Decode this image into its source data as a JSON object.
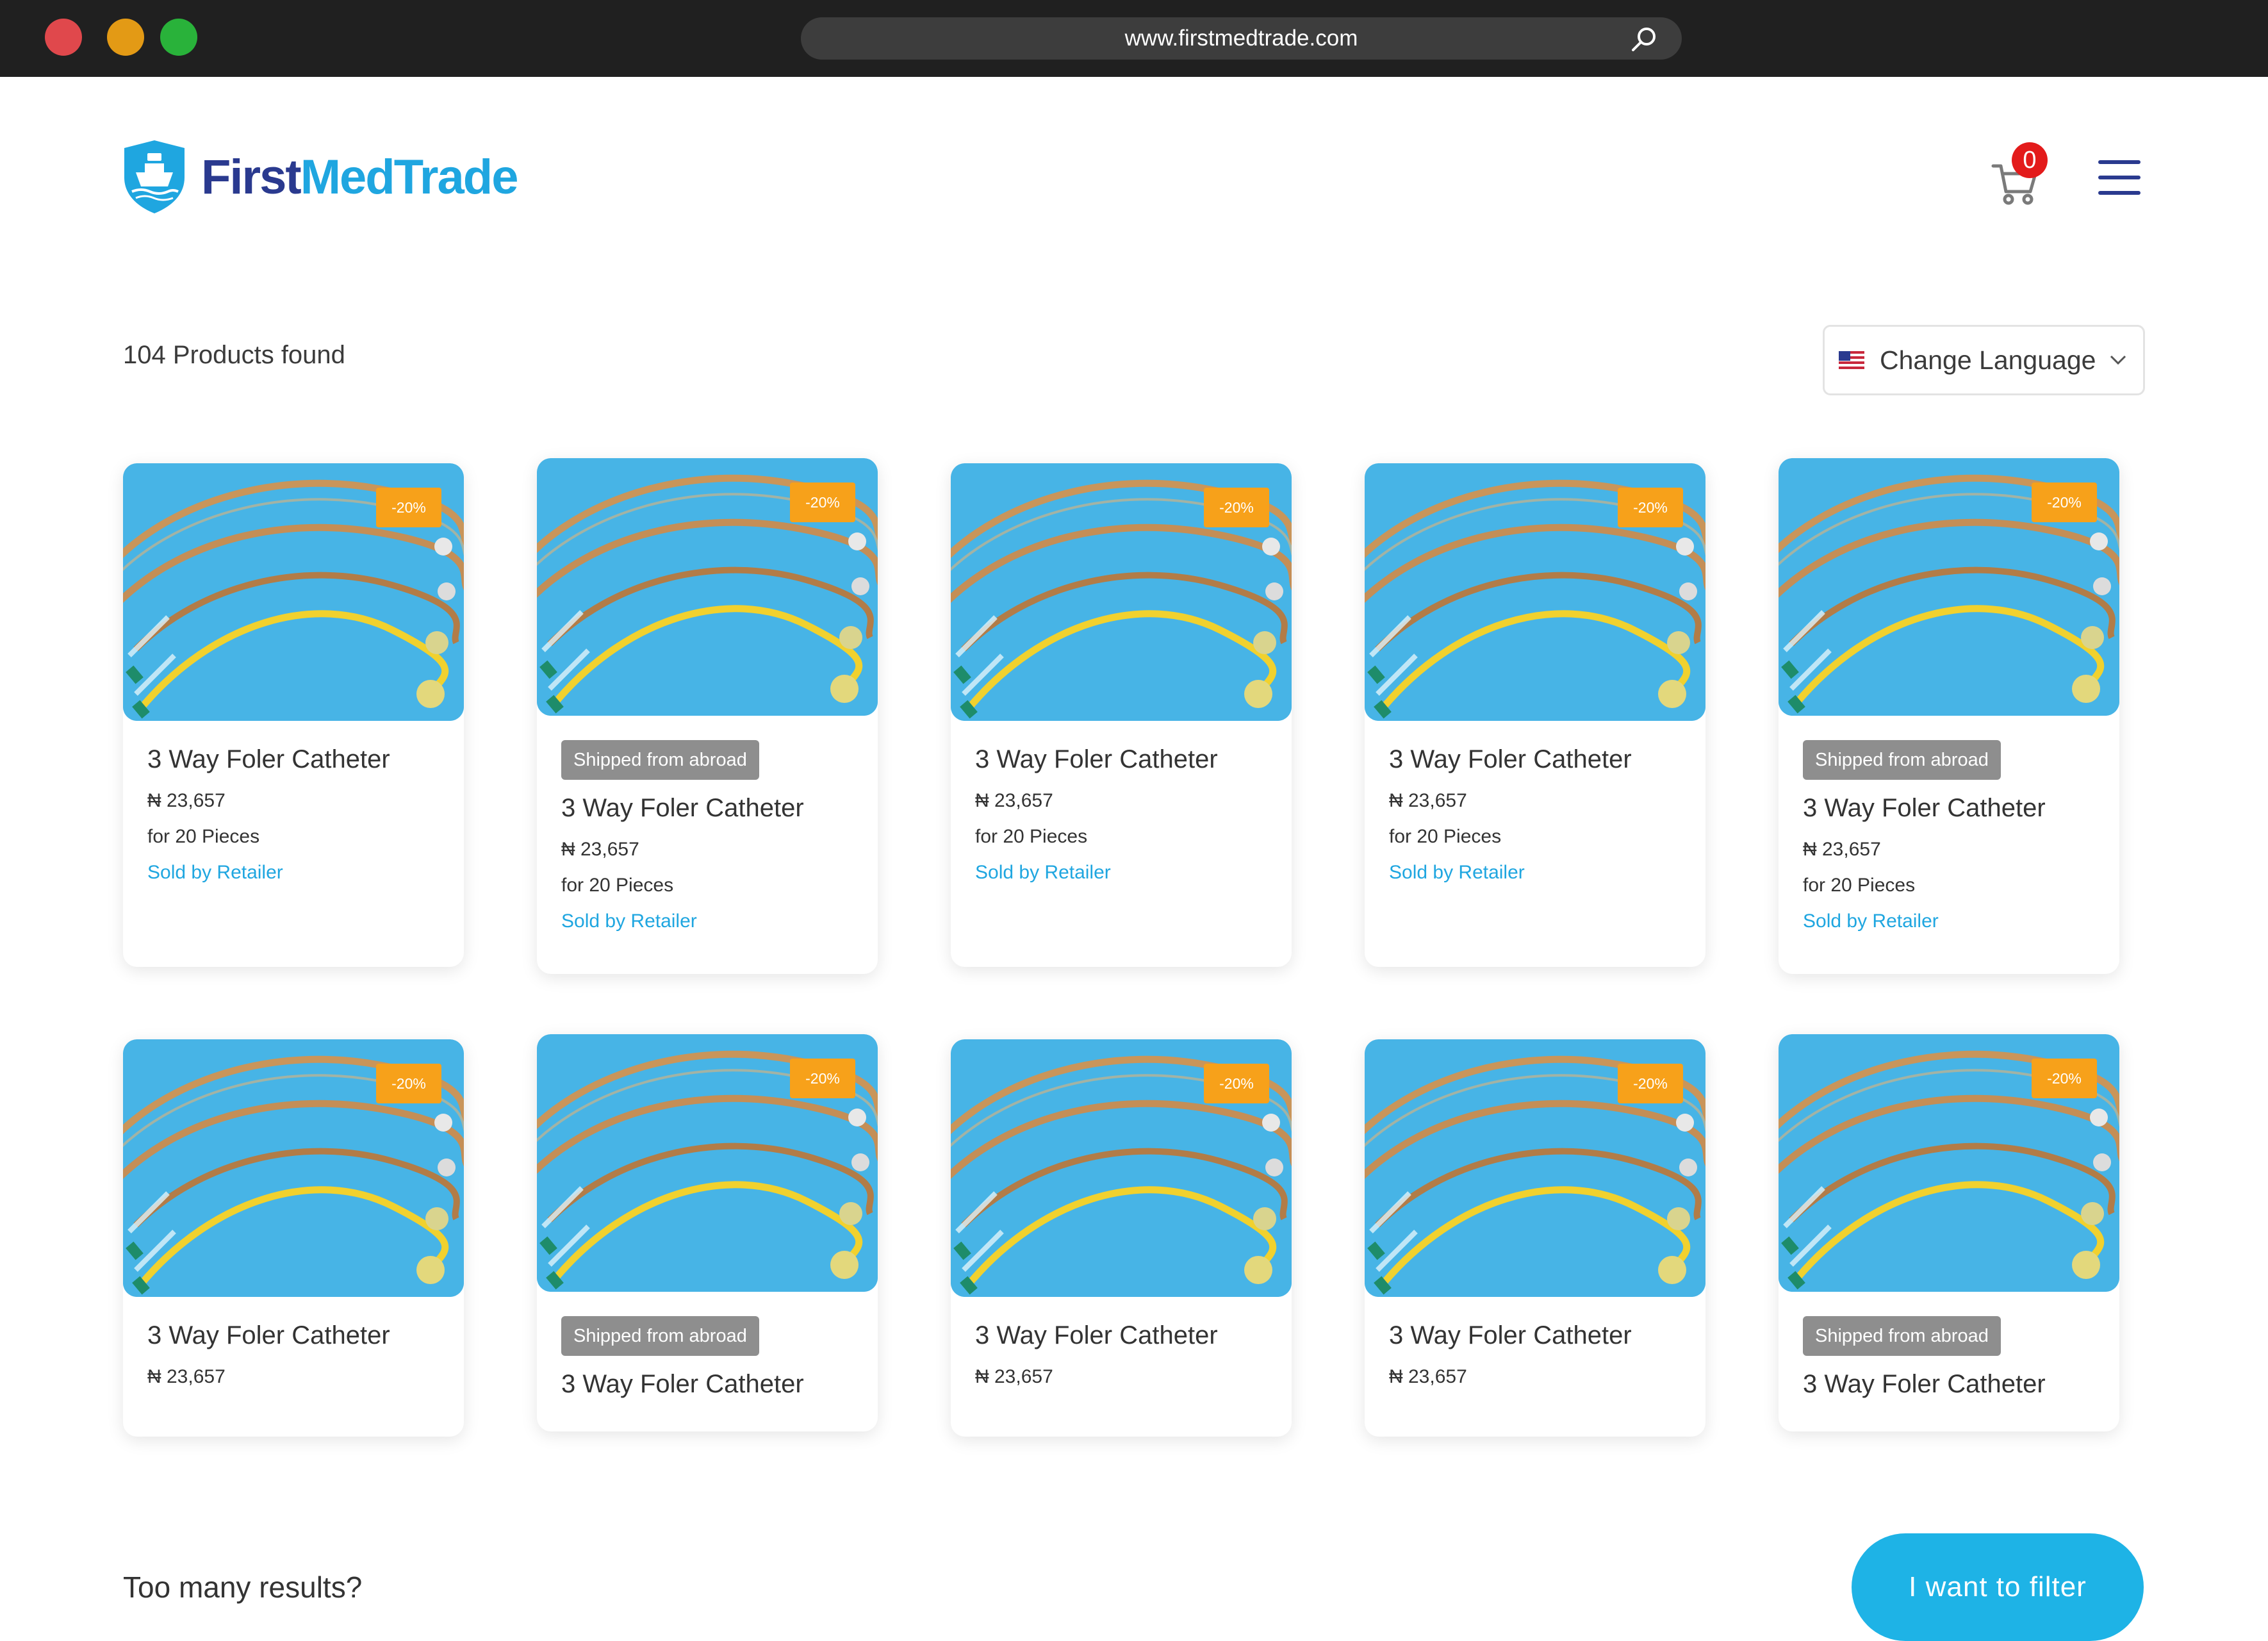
{
  "browser": {
    "url": "www.firstmedtrade.com"
  },
  "header": {
    "logo_first": "First",
    "logo_second": "MedTrade",
    "cart_count": "0"
  },
  "toolbar": {
    "results_text": "104 Products found",
    "language_label": "Change Language"
  },
  "products": [
    {
      "title": "3 Way Foler Catheter",
      "price": "₦ 23,657",
      "quantity": "for 20 Pieces",
      "seller": "Sold by Retailer",
      "discount": "-20%",
      "shipped": ""
    },
    {
      "title": "3 Way Foler Catheter",
      "price": "₦ 23,657",
      "quantity": "for 20 Pieces",
      "seller": "Sold by Retailer",
      "discount": "-20%",
      "shipped": "Shipped from abroad"
    },
    {
      "title": "3 Way Foler Catheter",
      "price": "₦ 23,657",
      "quantity": "for 20 Pieces",
      "seller": "Sold by Retailer",
      "discount": "-20%",
      "shipped": ""
    },
    {
      "title": "3 Way Foler Catheter",
      "price": "₦ 23,657",
      "quantity": "for 20 Pieces",
      "seller": "Sold by Retailer",
      "discount": "-20%",
      "shipped": ""
    },
    {
      "title": "3 Way Foler Catheter",
      "price": "₦ 23,657",
      "quantity": "for 20 Pieces",
      "seller": "Sold by Retailer",
      "discount": "-20%",
      "shipped": "Shipped from abroad"
    },
    {
      "title": "3 Way Foler Catheter",
      "price": "₦ 23,657",
      "quantity": "",
      "seller": "",
      "discount": "-20%",
      "shipped": ""
    },
    {
      "title": "3 Way Foler Catheter",
      "price": "",
      "quantity": "",
      "seller": "",
      "discount": "-20%",
      "shipped": "Shipped from abroad"
    },
    {
      "title": "3 Way Foler Catheter",
      "price": "₦ 23,657",
      "quantity": "",
      "seller": "",
      "discount": "-20%",
      "shipped": ""
    },
    {
      "title": "3 Way Foler Catheter",
      "price": "₦ 23,657",
      "quantity": "",
      "seller": "",
      "discount": "-20%",
      "shipped": ""
    },
    {
      "title": "3 Way Foler Catheter",
      "price": "",
      "quantity": "",
      "seller": "",
      "discount": "-20%",
      "shipped": "Shipped from abroad"
    }
  ],
  "footer": {
    "prompt": "Too many results?",
    "filter_button": "I want to filter"
  },
  "colors": {
    "accent": "#1eb3e6",
    "brand_dark": "#2a3a8f",
    "discount": "#f7a11a",
    "cart_badge": "#e31b1b"
  }
}
